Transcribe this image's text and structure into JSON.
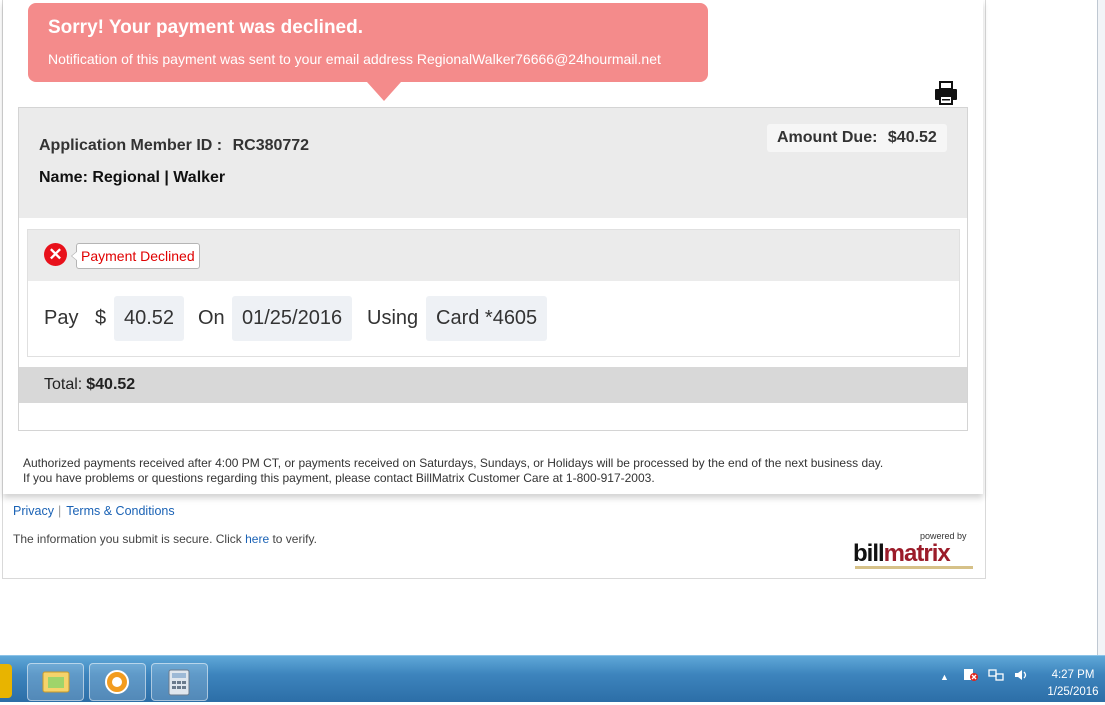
{
  "toast": {
    "title": "Sorry! Your payment was declined.",
    "message": "Notification of this payment was sent to your email address RegionalWalker76666@24hourmail.net"
  },
  "account": {
    "member_id_label": "Application Member ID :",
    "member_id": "RC380772",
    "name": "Name: Regional | Walker",
    "amount_due_label": "Amount Due:",
    "amount_due": "$40.52"
  },
  "payment": {
    "status": "Payment Declined",
    "pay_label": "Pay",
    "currency": "$",
    "amount": "40.52",
    "on_label": "On",
    "date": "01/25/2016",
    "using_label": "Using",
    "method": "Card *4605"
  },
  "total": {
    "label": "Total:",
    "value": "$40.52"
  },
  "disclaimer": {
    "line1": "Authorized payments received after 4:00 PM CT, or payments received on Saturdays, Sundays, or Holidays will be processed by the end of the next business day.",
    "line2": "If you have problems or questions regarding this payment, please contact BillMatrix Customer Care at 1-800-917-2003."
  },
  "footer": {
    "privacy": "Privacy",
    "terms": "Terms & Conditions",
    "secure_text": "The information you submit is secure. Click",
    "secure_link": "here",
    "secure_suffix": "to verify.",
    "powered_by": "powered by",
    "logo_bill": "bill",
    "logo_matrix": "matrix"
  },
  "taskbar": {
    "time": "4:27 PM",
    "date": "1/25/2016",
    "tray_arrow": "▲"
  },
  "colors": {
    "toast_bg": "#f48b8b",
    "error_red": "#e8111b",
    "link_blue": "#1a62b5"
  }
}
